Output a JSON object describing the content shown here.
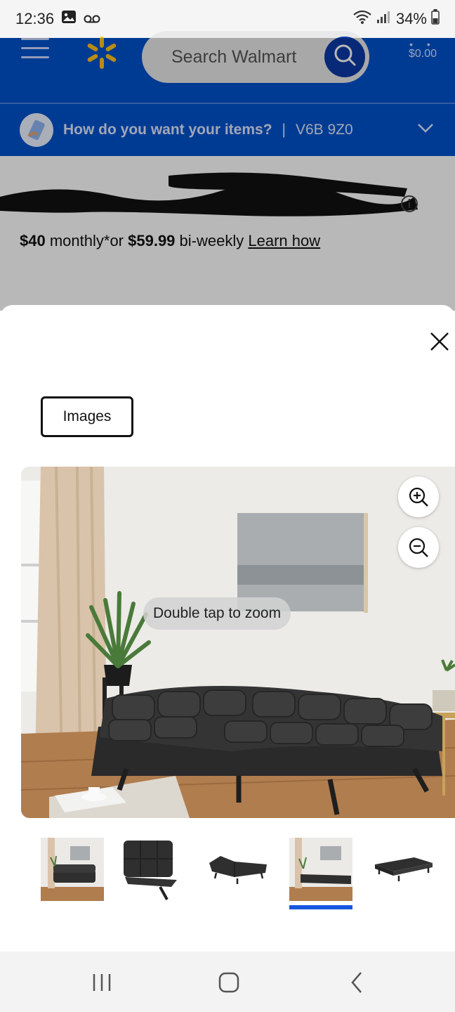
{
  "status_bar": {
    "time": "12:36",
    "battery": "34%",
    "icons": [
      "image-icon",
      "voicemail-icon",
      "wifi-icon",
      "signal-icon",
      "battery-icon"
    ]
  },
  "header": {
    "search_placeholder": "Search Walmart",
    "cart_total": "$0.00",
    "brand_color": "#0052cc",
    "spark_color": "#ffc220"
  },
  "delivery": {
    "question": "How do you want your items?",
    "separator": "|",
    "postal_code": "V6B 9Z0"
  },
  "background_product": {
    "monthly_amount": "$40",
    "monthly_text": "monthly*or",
    "biweekly_amount": "$59.99",
    "biweekly_text": "bi-weekly",
    "learn_link": "Learn how"
  },
  "modal": {
    "tab_label": "Images",
    "zoom_hint": "Double tap to zoom",
    "thumbnails_count": 5,
    "active_thumbnail": 4,
    "active_color": "#1757e0"
  }
}
